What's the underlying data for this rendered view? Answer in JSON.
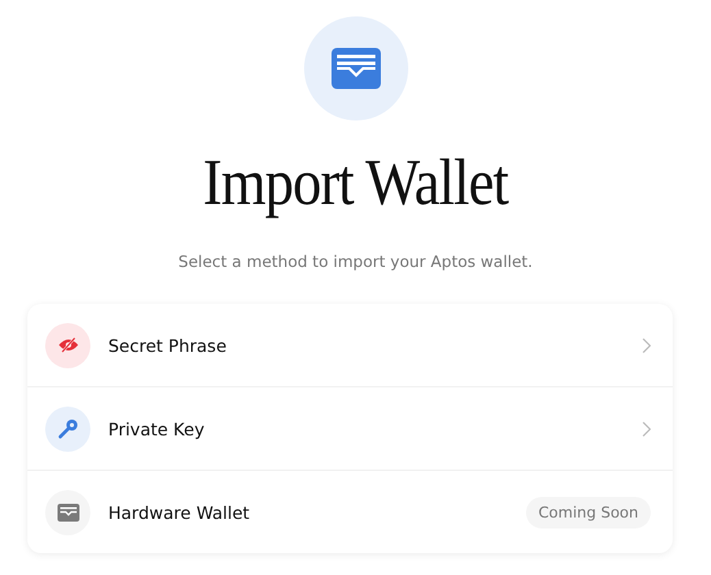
{
  "title": "Import Wallet",
  "subtitle": "Select a method to import your Aptos wallet.",
  "options": [
    {
      "label": "Secret Phrase",
      "kind": "link"
    },
    {
      "label": "Private Key",
      "kind": "link"
    },
    {
      "label": "Hardware Wallet",
      "kind": "soon",
      "badge": "Coming Soon"
    }
  ]
}
